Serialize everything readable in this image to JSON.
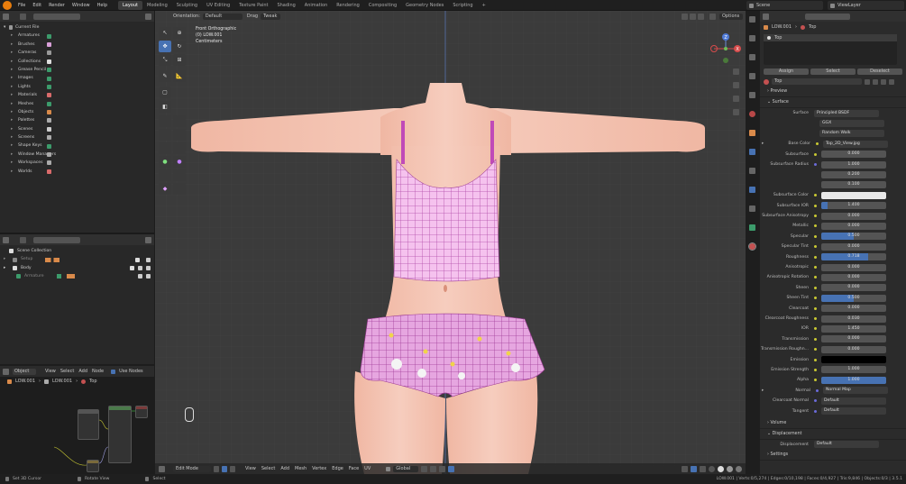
{
  "topbar": {
    "menus": [
      "File",
      "Edit",
      "Render",
      "Window",
      "Help"
    ],
    "workspaces": [
      "Layout",
      "Modeling",
      "Sculpting",
      "UV Editing",
      "Texture Paint",
      "Shading",
      "Animation",
      "Rendering",
      "Compositing",
      "Geometry Nodes",
      "Scripting"
    ],
    "active_workspace": "Layout",
    "add_tab": "+",
    "scene": "Scene",
    "view_layer": "ViewLayer"
  },
  "data_browser": {
    "root": "Current File",
    "items": [
      "Armatures",
      "Brushes",
      "Cameras",
      "Collections",
      "Grease Pencil",
      "Images",
      "Lights",
      "Materials",
      "Meshes",
      "Objects",
      "Palettes",
      "Scenes",
      "Screens",
      "Shape Keys",
      "Window Managers",
      "Workspaces",
      "Worlds"
    ]
  },
  "outliner": {
    "root": "Scene Collection",
    "items": [
      {
        "label": "Setup"
      },
      {
        "label": "Body"
      },
      {
        "label": "Armature"
      }
    ]
  },
  "node_editor": {
    "editor_type": "Object",
    "menus": [
      "View",
      "Select",
      "Add",
      "Node"
    ],
    "use_nodes": "Use Nodes",
    "breadcrumb": [
      "LOW.001",
      "LOW.001",
      "Top"
    ]
  },
  "viewport": {
    "orientation_label": "Orientation:",
    "orientation": "Default",
    "drag_label": "Drag",
    "drag": "Tweak",
    "options": "Options",
    "view_name": "Front Orthographic",
    "object_name": "(0) LOW.001",
    "units": "Centimeters",
    "mode": "Edit Mode",
    "header_menus": [
      "View",
      "Select",
      "Add",
      "Mesh",
      "Vertex",
      "Edge",
      "Face",
      "UV"
    ],
    "transform": "Global",
    "gizmo_axes": [
      "Z",
      "X"
    ]
  },
  "status": {
    "left": [
      {
        "label": "Set 3D Cursor"
      },
      {
        "label": "Rotate View"
      },
      {
        "label": "Select"
      }
    ],
    "stats": "LOW.001 | Verts:0/5,274 | Edges:0/10,198 | Faces:0/4,927 | Tris:9,846 | Objects:0/3 | 3.5.1"
  },
  "properties": {
    "object": "LOW.001",
    "material_slot": "Top",
    "slot_list_item": "Top",
    "buttons": [
      "Assign",
      "Select",
      "Deselect"
    ],
    "material_name": "Top",
    "sections": {
      "preview": "Preview",
      "surface": "Surface",
      "volume": "Volume",
      "displacement": "Displacement",
      "settings": "Settings"
    },
    "surface_shader": "Principled BSDF",
    "distribution": "GGX",
    "subsurface_method": "Random Walk",
    "rows": [
      {
        "label": "Base Color",
        "value": "Top_2D_View.jpg",
        "kind": "tex"
      },
      {
        "label": "Subsurface",
        "value": "0.000",
        "kind": "num"
      },
      {
        "label": "Subsurface Radius",
        "value": "1.000",
        "kind": "num"
      },
      {
        "label": "",
        "value": "0.200",
        "kind": "num"
      },
      {
        "label": "",
        "value": "0.100",
        "kind": "num"
      },
      {
        "label": "Subsurface Color",
        "value": "",
        "kind": "color",
        "color": "#e8e8e8"
      },
      {
        "label": "Subsurface IOR",
        "value": "1.400",
        "kind": "num",
        "fill": 0.1
      },
      {
        "label": "Subsurface Anisotropy",
        "value": "0.000",
        "kind": "num"
      },
      {
        "label": "Metallic",
        "value": "0.000",
        "kind": "num"
      },
      {
        "label": "Specular",
        "value": "0.500",
        "kind": "num",
        "fill": 0.5
      },
      {
        "label": "Specular Tint",
        "value": "0.000",
        "kind": "num"
      },
      {
        "label": "Roughness",
        "value": "0.718",
        "kind": "num",
        "fill": 0.718
      },
      {
        "label": "Anisotropic",
        "value": "0.000",
        "kind": "num"
      },
      {
        "label": "Anisotropic Rotation",
        "value": "0.000",
        "kind": "num"
      },
      {
        "label": "Sheen",
        "value": "0.000",
        "kind": "num"
      },
      {
        "label": "Sheen Tint",
        "value": "0.500",
        "kind": "num",
        "fill": 0.5
      },
      {
        "label": "Clearcoat",
        "value": "0.000",
        "kind": "num"
      },
      {
        "label": "Clearcoat Roughness",
        "value": "0.030",
        "kind": "num"
      },
      {
        "label": "IOR",
        "value": "1.450",
        "kind": "num"
      },
      {
        "label": "Transmission",
        "value": "0.000",
        "kind": "num"
      },
      {
        "label": "Transmission Roughn...",
        "value": "0.000",
        "kind": "num"
      },
      {
        "label": "Emission",
        "value": "",
        "kind": "color",
        "color": "#000000"
      },
      {
        "label": "Emission Strength",
        "value": "1.000",
        "kind": "num"
      },
      {
        "label": "Alpha",
        "value": "1.000",
        "kind": "num",
        "fill": 1.0
      },
      {
        "label": "Normal",
        "value": "Normal Map",
        "kind": "tex"
      },
      {
        "label": "Clearcoat Normal",
        "value": "Default",
        "kind": "text"
      },
      {
        "label": "Tangent",
        "value": "Default",
        "kind": "text"
      }
    ],
    "displacement_label": "Displacement",
    "displacement_value": "Default"
  }
}
